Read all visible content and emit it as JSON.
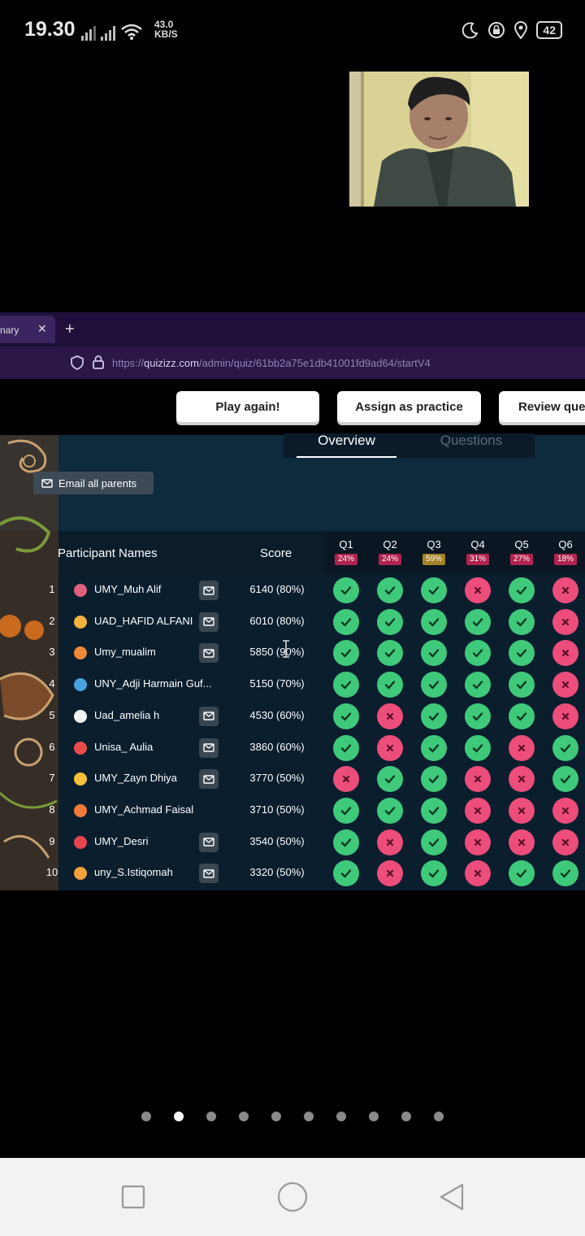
{
  "status_bar": {
    "time": "19.30",
    "net_speed_value": "43.0",
    "net_speed_unit": "KB/S",
    "battery": "42"
  },
  "browser": {
    "tab_label": "nary",
    "url_prefix": "https://",
    "url_domain": "quizizz.com",
    "url_path": "/admin/quiz/61bb2a75e1db41001fd9ad64/startV4"
  },
  "actions": {
    "play_again": "Play again!",
    "assign_practice": "Assign as practice",
    "review": "Review que"
  },
  "report_tabs": {
    "overview": "Overview",
    "questions": "Questions"
  },
  "email_all_parents": "Email all parents",
  "table": {
    "col_names": "Participant Names",
    "col_score": "Score",
    "questions": [
      {
        "label": "Q1",
        "pct": "24%",
        "color": "#b0244f"
      },
      {
        "label": "Q2",
        "pct": "24%",
        "color": "#b0244f"
      },
      {
        "label": "Q3",
        "pct": "59%",
        "color": "#a4822a"
      },
      {
        "label": "Q4",
        "pct": "31%",
        "color": "#b0244f"
      },
      {
        "label": "Q5",
        "pct": "27%",
        "color": "#b0244f"
      },
      {
        "label": "Q6",
        "pct": "18%",
        "color": "#b0244f"
      }
    ],
    "rows": [
      {
        "num": "1",
        "name": "UMY_Muh Alif",
        "score": "6140 (80%)",
        "mail": true,
        "avatar": "#e0607e",
        "answers": [
          1,
          1,
          1,
          0,
          1,
          0
        ]
      },
      {
        "num": "2",
        "name": "UAD_HAFID ALFANI",
        "score": "6010 (80%)",
        "mail": true,
        "avatar": "#f2b33d",
        "answers": [
          1,
          1,
          1,
          1,
          1,
          0
        ]
      },
      {
        "num": "3",
        "name": "Umy_mualim",
        "score": "5850 (90%)",
        "mail": true,
        "avatar": "#f08b3b",
        "answers": [
          1,
          1,
          1,
          1,
          1,
          0
        ]
      },
      {
        "num": "4",
        "name": "UNY_Adji Harmain Guf...",
        "score": "5150 (70%)",
        "mail": false,
        "avatar": "#4aa3df",
        "answers": [
          1,
          1,
          1,
          1,
          1,
          0
        ]
      },
      {
        "num": "5",
        "name": "Uad_amelia h",
        "score": "4530 (60%)",
        "mail": true,
        "avatar": "#f2f2f2",
        "answers": [
          1,
          0,
          1,
          1,
          1,
          0
        ]
      },
      {
        "num": "6",
        "name": "Unisa_ Aulia",
        "score": "3860 (60%)",
        "mail": true,
        "avatar": "#e94b4b",
        "answers": [
          1,
          0,
          1,
          1,
          0,
          1
        ]
      },
      {
        "num": "7",
        "name": "UMY_Zayn Dhiya",
        "score": "3770 (50%)",
        "mail": true,
        "avatar": "#f3c13a",
        "answers": [
          0,
          1,
          1,
          0,
          0,
          1
        ]
      },
      {
        "num": "8",
        "name": "UMY_Achmad Faisal",
        "score": "3710 (50%)",
        "mail": false,
        "avatar": "#f07a3a",
        "answers": [
          1,
          1,
          1,
          0,
          0,
          0
        ]
      },
      {
        "num": "9",
        "name": "UMY_Desri",
        "score": "3540 (50%)",
        "mail": true,
        "avatar": "#e6454f",
        "answers": [
          1,
          0,
          1,
          0,
          0,
          0
        ]
      },
      {
        "num": "10",
        "name": "uny_S.Istiqomah",
        "score": "3320 (50%)",
        "mail": true,
        "avatar": "#f0a23b",
        "answers": [
          1,
          0,
          1,
          0,
          1,
          1
        ]
      }
    ]
  },
  "pager": {
    "count": 10,
    "active": 1
  },
  "colors": {
    "correct": "#3fc97b",
    "incorrect": "#ec4d7b",
    "browser": "#2a1748"
  }
}
